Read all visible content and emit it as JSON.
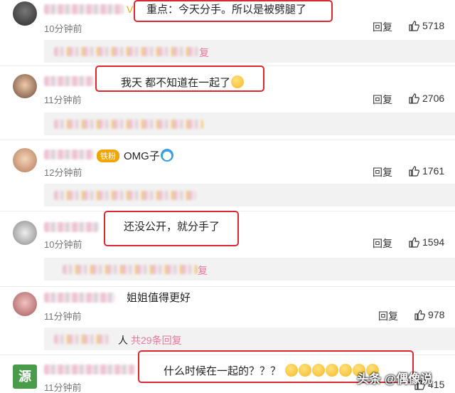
{
  "comments": [
    {
      "text": "重点：今天分手。所以是被劈腿了",
      "time": "10分钟前",
      "reply": "回复",
      "likes": "5718",
      "sub": {
        "trailing": "复"
      }
    },
    {
      "text": "我天 都不知道在一起了",
      "time": "11分钟前",
      "reply": "回复",
      "likes": "2706"
    },
    {
      "text": "OMG子",
      "badge": "铁粉",
      "time": "12分钟前",
      "reply": "回复",
      "likes": "1761"
    },
    {
      "text": "还没公开，就分手了",
      "time": "10分钟前",
      "reply": "回复",
      "likes": "1594",
      "sub": {
        "trailing": "复"
      }
    },
    {
      "text": "姐姐值得更好",
      "time": "11分钟前",
      "reply": "回复",
      "likes": "978",
      "sub": {
        "name_tail": "人",
        "more_replies": "共29条回复"
      }
    },
    {
      "text": "什么时候在一起的？？？",
      "time": "11分钟前",
      "reply": "回复",
      "likes": "415",
      "avatar_char": "源"
    }
  ],
  "watermark": "头条 @偶像说",
  "colors": {
    "highlight": "#d9282f",
    "link_pink": "#e8779b"
  }
}
